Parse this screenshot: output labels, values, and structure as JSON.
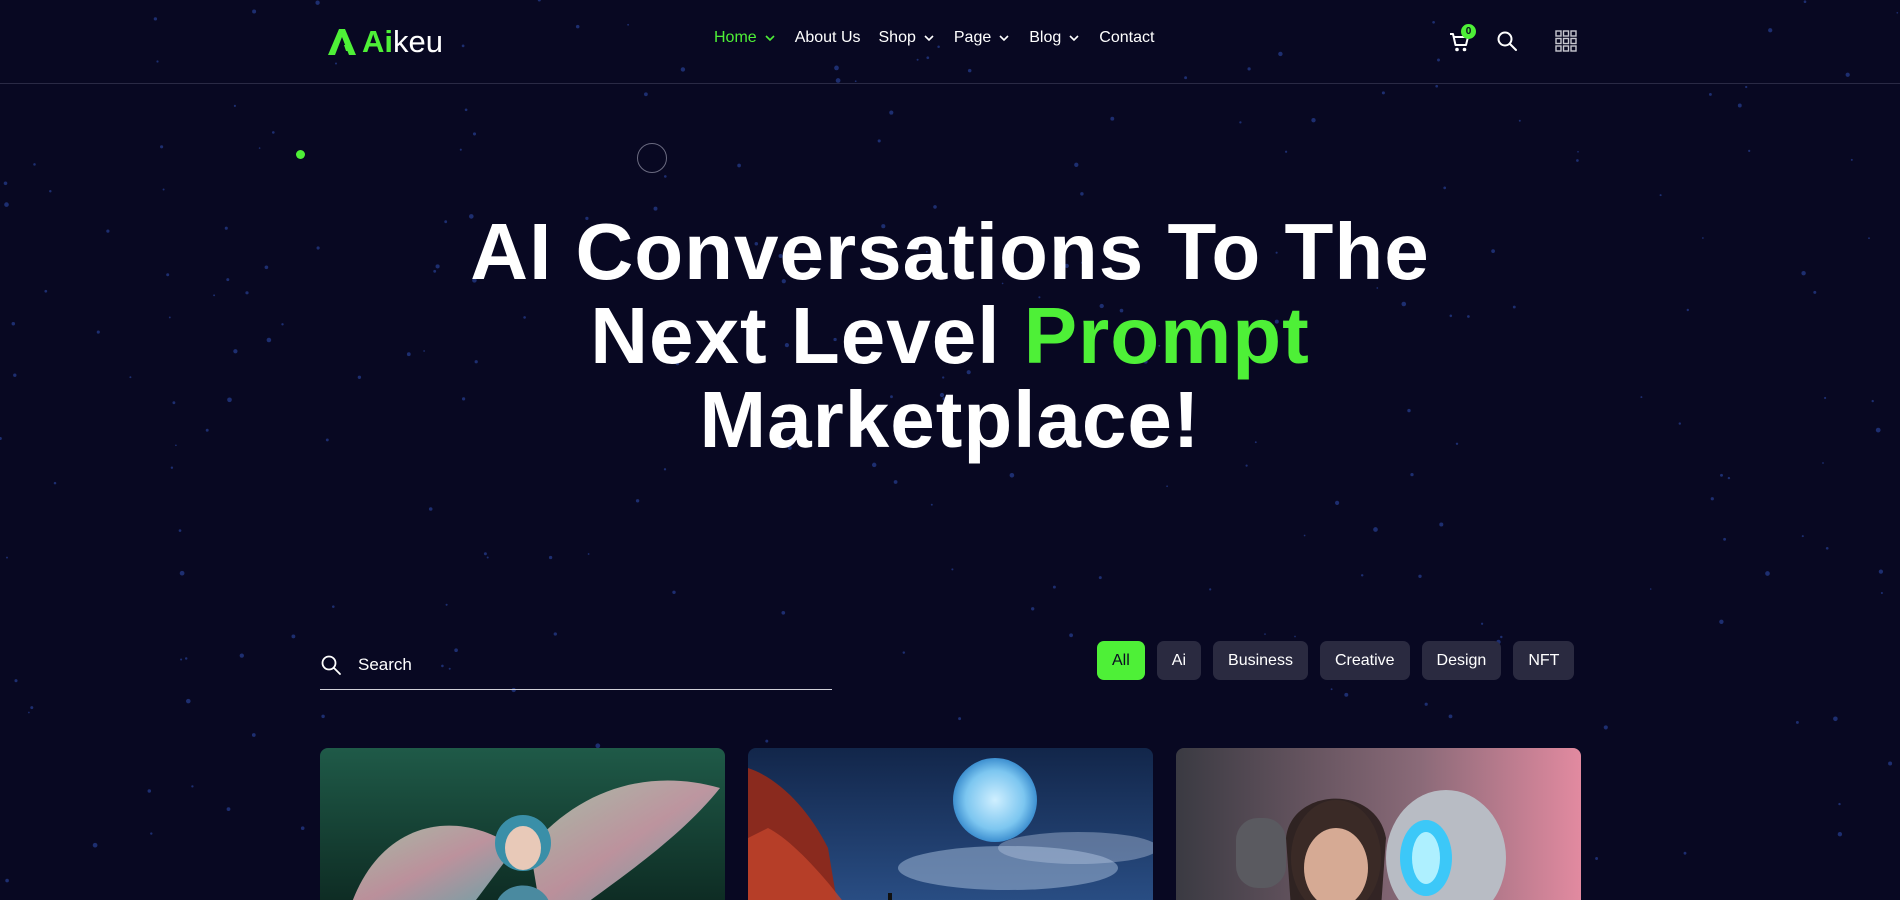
{
  "brand": {
    "logo_highlight": "Ai",
    "logo_rest": "keu",
    "accent_color": "#4ef037",
    "background_color": "#080822"
  },
  "nav": {
    "items": [
      {
        "label": "Home",
        "dropdown": true,
        "active": true
      },
      {
        "label": "About Us",
        "dropdown": false,
        "active": false
      },
      {
        "label": "Shop",
        "dropdown": true,
        "active": false
      },
      {
        "label": "Page",
        "dropdown": true,
        "active": false
      },
      {
        "label": "Blog",
        "dropdown": true,
        "active": false
      },
      {
        "label": "Contact",
        "dropdown": false,
        "active": false
      }
    ]
  },
  "header_icons": {
    "cart_icon": "cart-icon",
    "cart_count": "0",
    "search_icon": "search-icon",
    "menu_icon": "grid-menu-icon"
  },
  "hero": {
    "line1": "AI Conversations To The",
    "line2_prefix": "Next Level ",
    "line2_highlight": "Prompt",
    "line3": "Marketplace!"
  },
  "search": {
    "placeholder": "Search"
  },
  "filters": [
    {
      "label": "All",
      "active": true
    },
    {
      "label": "Ai",
      "active": false
    },
    {
      "label": "Business",
      "active": false
    },
    {
      "label": "Creative",
      "active": false
    },
    {
      "label": "Design",
      "active": false
    },
    {
      "label": "NFT",
      "active": false
    }
  ],
  "cards": [
    {
      "image": "fairy-with-wings"
    },
    {
      "image": "full-moon-night-sky"
    },
    {
      "image": "woman-and-robot-with-headphones"
    }
  ]
}
